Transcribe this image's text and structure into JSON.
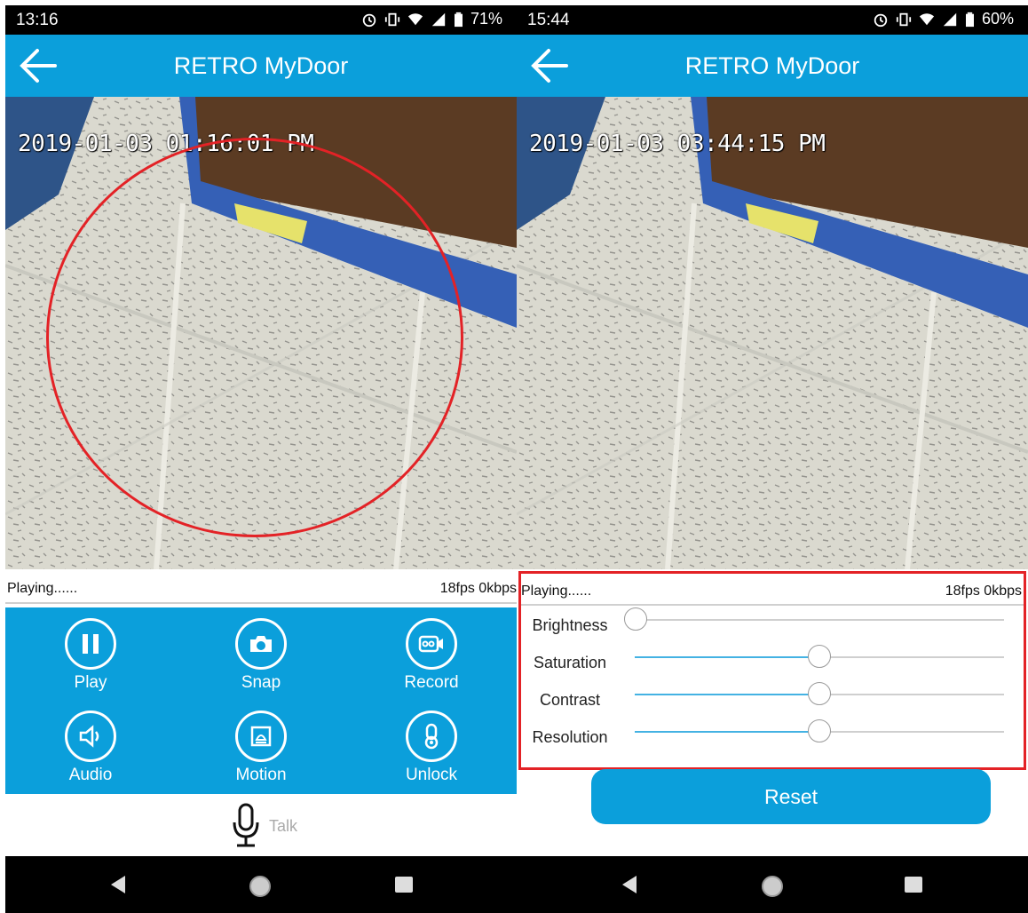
{
  "screens": [
    {
      "status_time": "13:16",
      "status_battery": "71%",
      "app_title": "RETRO MyDoor",
      "video_timestamp": "2019-01-03 01:16:01 PM",
      "play_status": "Playing......",
      "stream_info": "18fps 0kbps",
      "controls": [
        {
          "label": "Play",
          "icon": "pause-icon"
        },
        {
          "label": "Snap",
          "icon": "camera-icon"
        },
        {
          "label": "Record",
          "icon": "video-record-icon"
        },
        {
          "label": "Audio",
          "icon": "speaker-icon"
        },
        {
          "label": "Motion",
          "icon": "motion-alarm-icon"
        },
        {
          "label": "Unlock",
          "icon": "key-icon"
        }
      ],
      "talk_label": "Talk"
    },
    {
      "status_time": "15:44",
      "status_battery": "60%",
      "app_title": "RETRO MyDoor",
      "video_timestamp": "2019-01-03 03:44:15 PM",
      "play_status": "Playing......",
      "stream_info": "18fps 0kbps",
      "sliders": [
        {
          "label": "Brightness",
          "value": 0.0
        },
        {
          "label": "Saturation",
          "value": 0.5
        },
        {
          "label": "Contrast",
          "value": 0.5
        },
        {
          "label": "Resolution",
          "value": 0.5
        }
      ],
      "reset_label": "Reset"
    }
  ],
  "colors": {
    "accent": "#0b9fdb",
    "annotation_red": "#e32226",
    "slider_fill": "#44b2e3"
  }
}
